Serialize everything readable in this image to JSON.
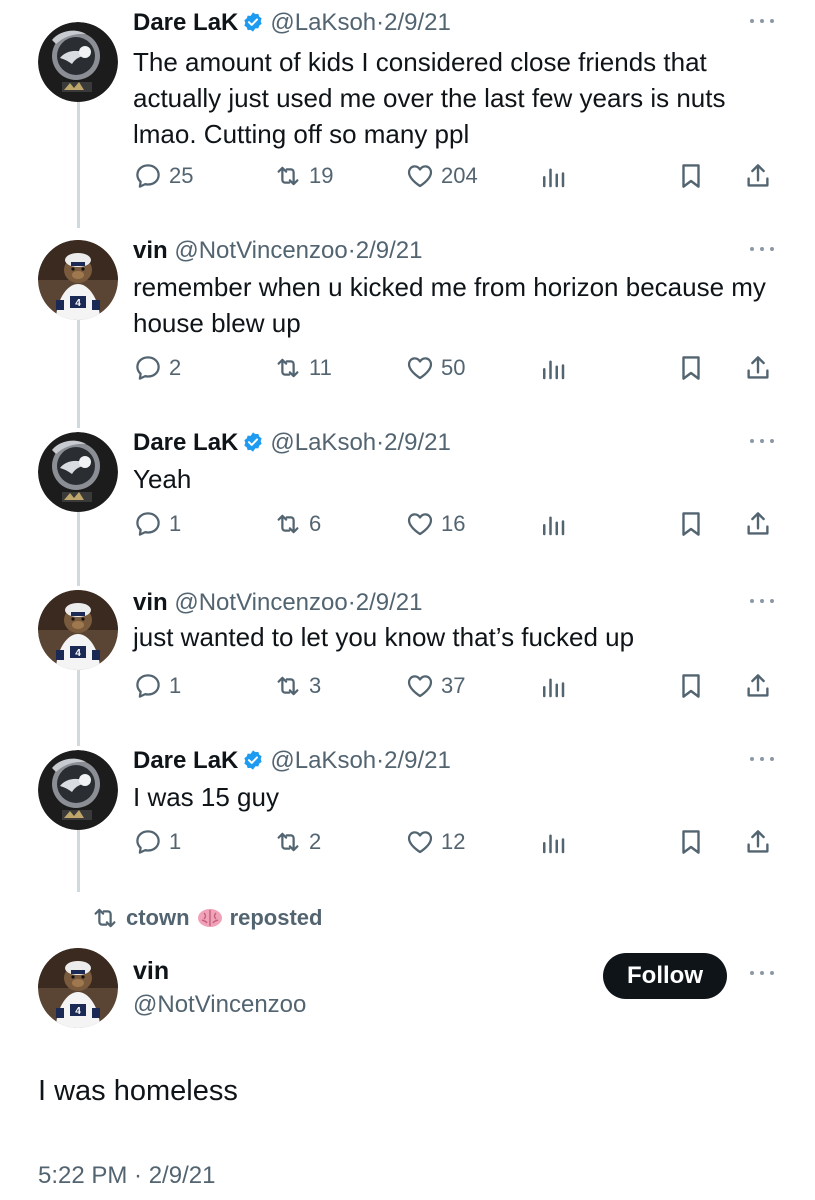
{
  "colors": {
    "text": "#0f1419",
    "secondary": "#536471",
    "verified": "#1d9bf0",
    "follow_bg": "#0f1419"
  },
  "tweets": [
    {
      "name": "Dare LaK",
      "verified": true,
      "handle": "@LaKsoh",
      "dot": "·",
      "date": "2/9/21",
      "text": "The amount of kids I considered close friends that actually just used me over the last few years is nuts lmao. Cutting off so many ppl",
      "replies": "25",
      "reposts": "19",
      "likes": "204",
      "avatar": "lak-logo-avatar"
    },
    {
      "name": "vin",
      "verified": false,
      "handle": "@NotVincenzoo",
      "dot": "·",
      "date": "2/9/21",
      "text": "remember when u kicked me from horizon because my house blew up",
      "replies": "2",
      "reposts": "11",
      "likes": "50",
      "avatar": "plush-toy-avatar"
    },
    {
      "name": "Dare LaK",
      "verified": true,
      "handle": "@LaKsoh",
      "dot": "·",
      "date": "2/9/21",
      "text": "Yeah",
      "replies": "1",
      "reposts": "6",
      "likes": "16",
      "avatar": "lak-logo-avatar"
    },
    {
      "name": "vin",
      "verified": false,
      "handle": "@NotVincenzoo",
      "dot": "·",
      "date": "2/9/21",
      "text": "just wanted to let you know that’s fucked up",
      "replies": "1",
      "reposts": "3",
      "likes": "37",
      "avatar": "plush-toy-avatar"
    },
    {
      "name": "Dare LaK",
      "verified": true,
      "handle": "@LaKsoh",
      "dot": "·",
      "date": "2/9/21",
      "text": "I was 15 guy",
      "replies": "1",
      "reposts": "2",
      "likes": "12",
      "avatar": "lak-logo-avatar"
    }
  ],
  "repost_banner": {
    "user": "ctown",
    "emoji_icon": "brain-icon",
    "label": "reposted"
  },
  "main_tweet": {
    "name": "vin",
    "handle": "@NotVincenzoo",
    "follow_label": "Follow",
    "text": "I was homeless",
    "timestamp": "5:22 PM · 2/9/21"
  }
}
